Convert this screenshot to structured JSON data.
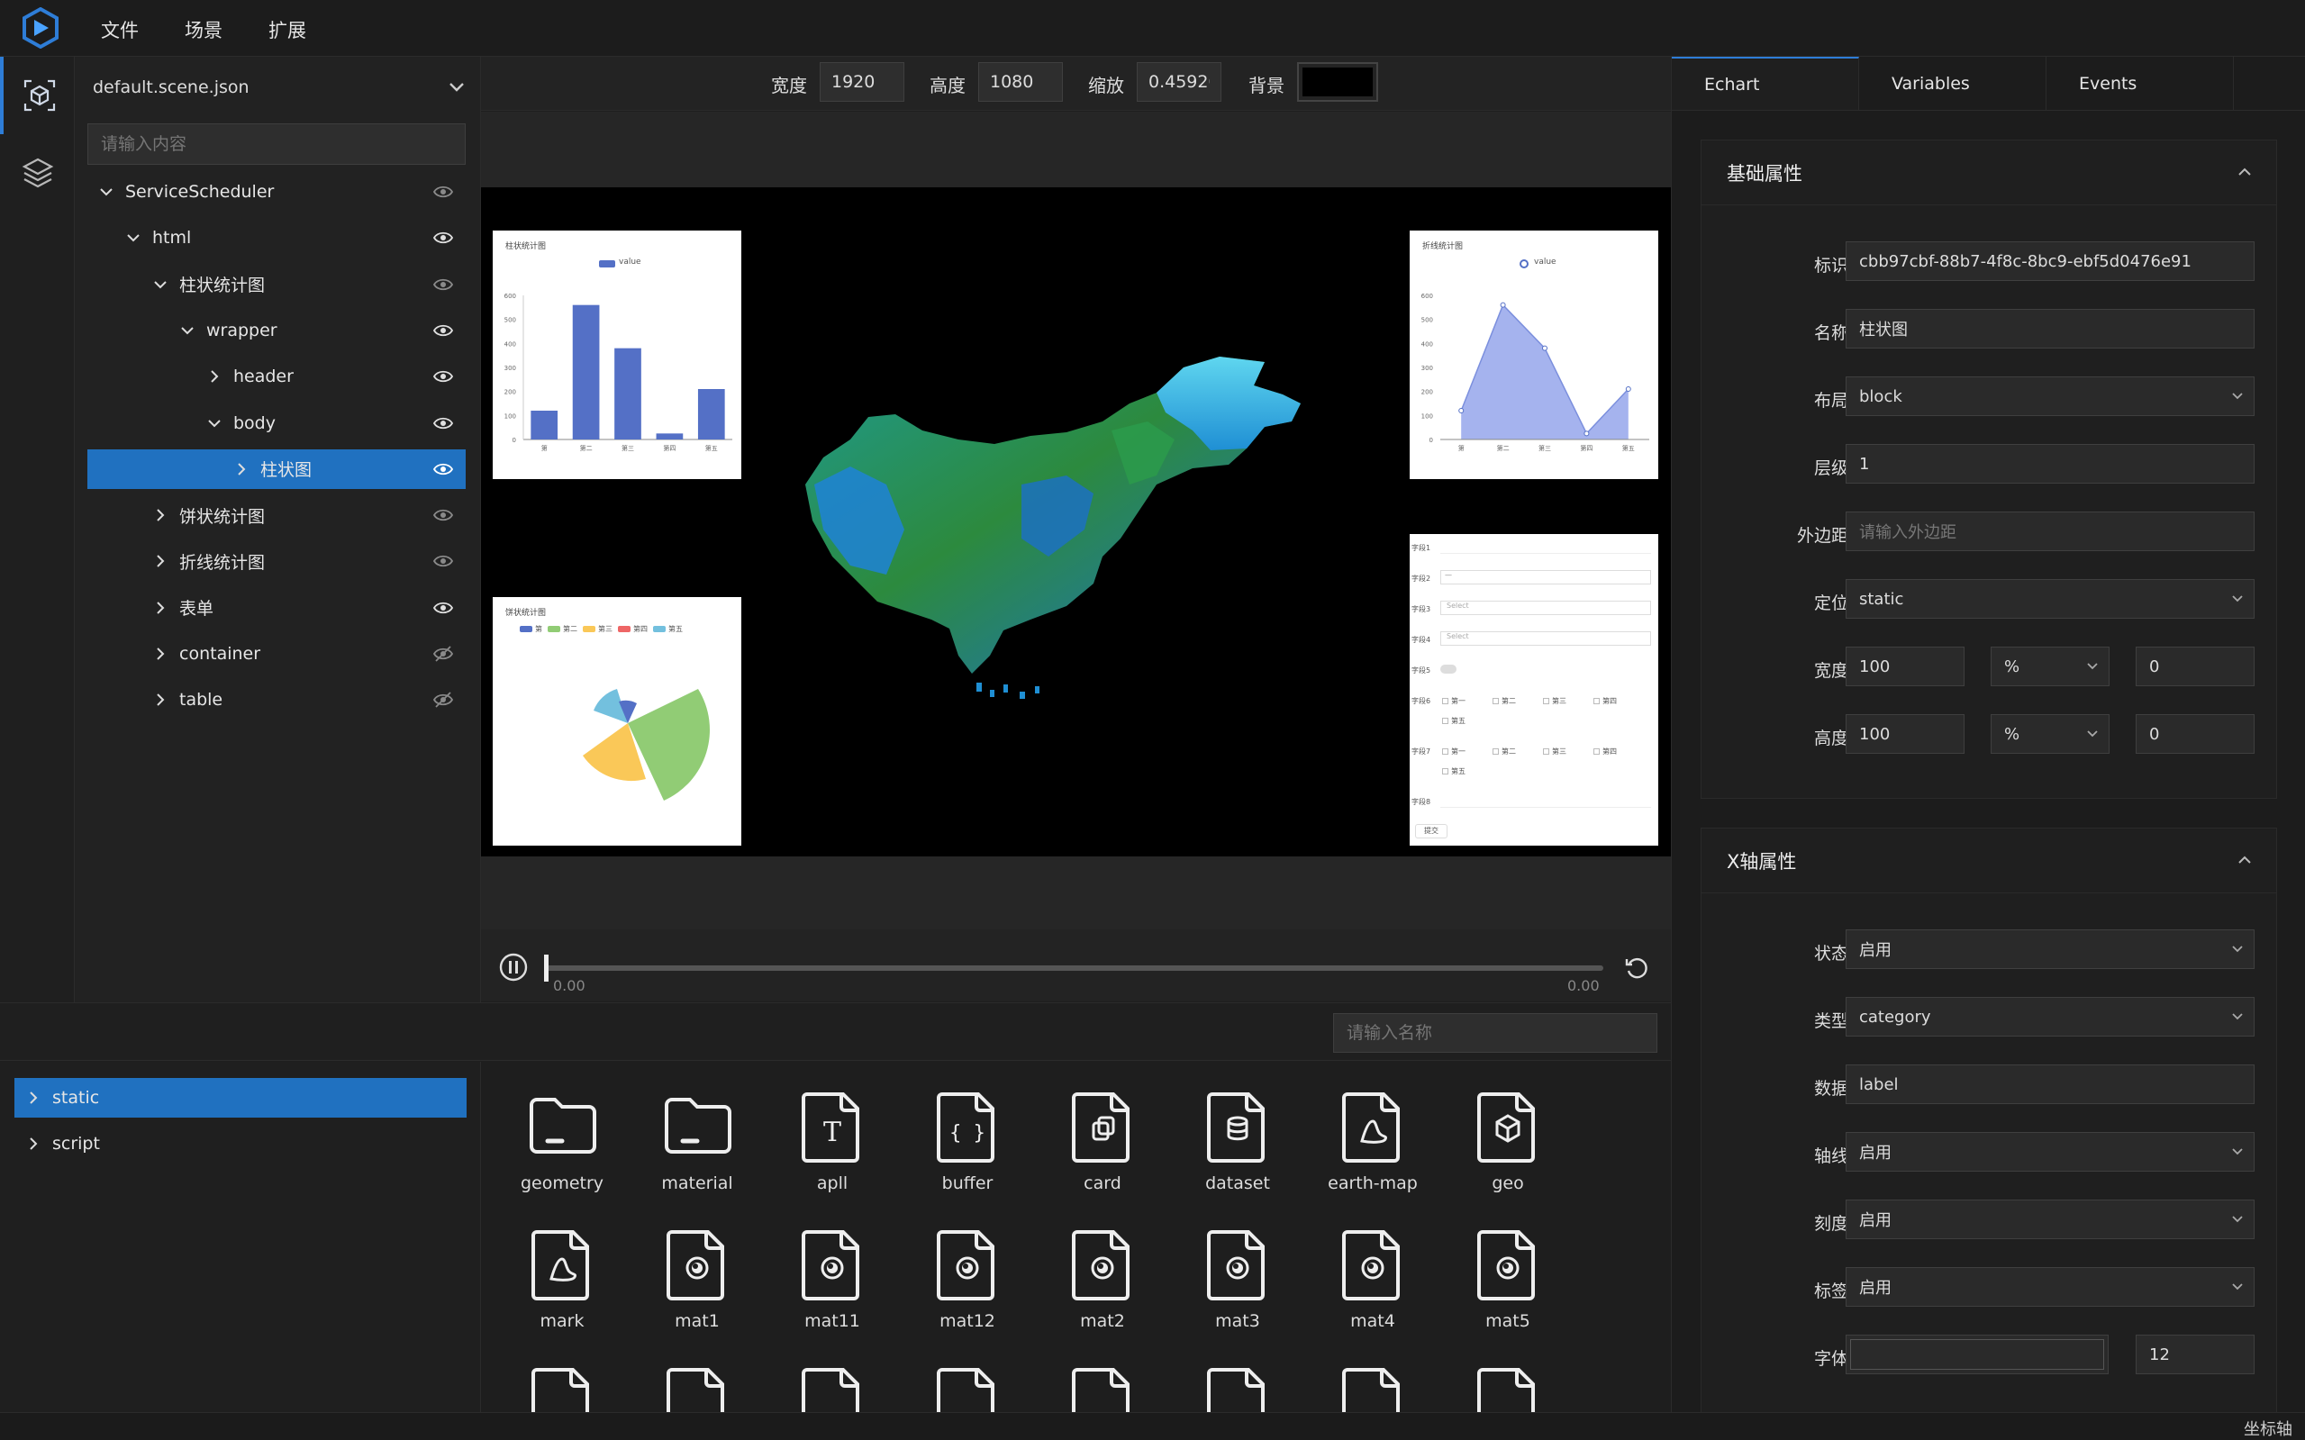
{
  "menubar": {
    "items": [
      "文件",
      "场景",
      "扩展"
    ]
  },
  "scene": {
    "file": "default.scene.json",
    "search_placeholder": "请输入内容",
    "tree": [
      {
        "label": "ServiceScheduler",
        "depth": 0,
        "expanded": true,
        "visible": true,
        "selected": false
      },
      {
        "label": "html",
        "depth": 1,
        "expanded": true,
        "visible": true,
        "selected": false
      },
      {
        "label": "柱状统计图",
        "depth": 2,
        "expanded": true,
        "visible": true,
        "selected": false
      },
      {
        "label": "wrapper",
        "depth": 3,
        "expanded": true,
        "visible": true,
        "selected": false
      },
      {
        "label": "header",
        "depth": 4,
        "expanded": false,
        "visible": true,
        "selected": false
      },
      {
        "label": "body",
        "depth": 4,
        "expanded": true,
        "visible": true,
        "selected": false
      },
      {
        "label": "柱状图",
        "depth": 5,
        "expanded": false,
        "visible": true,
        "selected": true
      },
      {
        "label": "饼状统计图",
        "depth": 2,
        "expanded": false,
        "visible": true,
        "selected": false
      },
      {
        "label": "折线统计图",
        "depth": 2,
        "expanded": false,
        "visible": true,
        "selected": false
      },
      {
        "label": "表单",
        "depth": 2,
        "expanded": false,
        "visible": true,
        "selected": false
      },
      {
        "label": "container",
        "depth": 2,
        "expanded": false,
        "visible": false,
        "selected": false
      },
      {
        "label": "table",
        "depth": 2,
        "expanded": false,
        "visible": false,
        "selected": false
      }
    ]
  },
  "toolbar": {
    "width_label": "宽度",
    "width_value": "1920",
    "height_label": "高度",
    "height_value": "1080",
    "scale_label": "缩放",
    "scale_value": "0.45920",
    "bg_label": "背景",
    "bg_color": "#000000"
  },
  "stage": {
    "bar_card": {
      "title": "柱状统计图",
      "legend": "value",
      "yticks": [
        "600",
        "500",
        "400",
        "300",
        "200",
        "100",
        "0"
      ],
      "categories": [
        "第",
        "第二",
        "第三",
        "第四",
        "第五"
      ],
      "values": [
        120,
        560,
        380,
        25,
        210
      ],
      "ymax": 600
    },
    "line_card": {
      "title": "折线统计图",
      "legend": "value",
      "yticks": [
        "600",
        "500",
        "400",
        "300",
        "200",
        "100",
        "0"
      ],
      "categories": [
        "第",
        "第二",
        "第三",
        "第四",
        "第五"
      ],
      "values": [
        120,
        560,
        380,
        25,
        210
      ],
      "ymax": 600
    },
    "pie_card": {
      "title": "饼状统计图",
      "legend": [
        "第",
        "第二",
        "第三",
        "第四",
        "第五"
      ],
      "legend_colors": [
        "#5470c6",
        "#91cc75",
        "#fac858",
        "#ee6666",
        "#73c0de"
      ]
    },
    "form_card": {
      "fields": [
        "字段1",
        "字段2",
        "字段3",
        "字段4",
        "字段5",
        "字段6",
        "字段7",
        "字段8"
      ],
      "select_placeholder": "Select",
      "checkbox_options": [
        "第一",
        "第二",
        "第三",
        "第四",
        "第五"
      ],
      "submit": "提交"
    }
  },
  "playback": {
    "start": "0.00",
    "end": "0.00",
    "progress": 0
  },
  "assets": {
    "search_placeholder": "请输入名称",
    "folders": [
      {
        "label": "static",
        "selected": true
      },
      {
        "label": "script",
        "selected": false
      }
    ],
    "row1": [
      {
        "label": "geometry",
        "icon": "folder-icon"
      },
      {
        "label": "material",
        "icon": "folder-icon"
      },
      {
        "label": "apll",
        "icon": "text-file-icon"
      },
      {
        "label": "buffer",
        "icon": "json-file-icon"
      },
      {
        "label": "card",
        "icon": "copy-file-icon"
      },
      {
        "label": "dataset",
        "icon": "database-file-icon"
      },
      {
        "label": "earth-map",
        "icon": "image-file-icon"
      },
      {
        "label": "geo",
        "icon": "cube-file-icon"
      }
    ],
    "row2": [
      {
        "label": "mark",
        "icon": "image-file-icon"
      },
      {
        "label": "mat1",
        "icon": "material-file-icon"
      },
      {
        "label": "mat11",
        "icon": "material-file-icon"
      },
      {
        "label": "mat12",
        "icon": "material-file-icon"
      },
      {
        "label": "mat2",
        "icon": "material-file-icon"
      },
      {
        "label": "mat3",
        "icon": "material-file-icon"
      },
      {
        "label": "mat4",
        "icon": "material-file-icon"
      },
      {
        "label": "mat5",
        "icon": "material-file-icon"
      }
    ]
  },
  "right": {
    "tabs": [
      "Echart",
      "Variables",
      "Events"
    ],
    "basic": {
      "title": "基础属性",
      "id_label": "标识",
      "id_value": "cbb97cbf-88b7-4f8c-8bc9-ebf5d0476e91",
      "name_label": "名称",
      "name_value": "柱状图",
      "layout_label": "布局",
      "layout_value": "block",
      "z_label": "层级",
      "z_value": "1",
      "margin_label": "外边距",
      "margin_placeholder": "请输入外边距",
      "position_label": "定位",
      "position_value": "static",
      "width_label": "宽度",
      "width_value": "100",
      "width_unit": "%",
      "width_offset": "0",
      "height_label": "高度",
      "height_value": "100",
      "height_unit": "%",
      "height_offset": "0"
    },
    "xaxis": {
      "title": "X轴属性",
      "state_label": "状态",
      "state_value": "启用",
      "type_label": "类型",
      "type_value": "category",
      "data_label": "数据",
      "data_value": "label",
      "axisline_label": "轴线",
      "axisline_value": "启用",
      "tick_label": "刻度",
      "tick_value": "启用",
      "labels_label": "标签",
      "labels_value": "启用",
      "font_label": "字体",
      "font_size": "12"
    }
  },
  "status": {
    "text": "坐标轴"
  }
}
